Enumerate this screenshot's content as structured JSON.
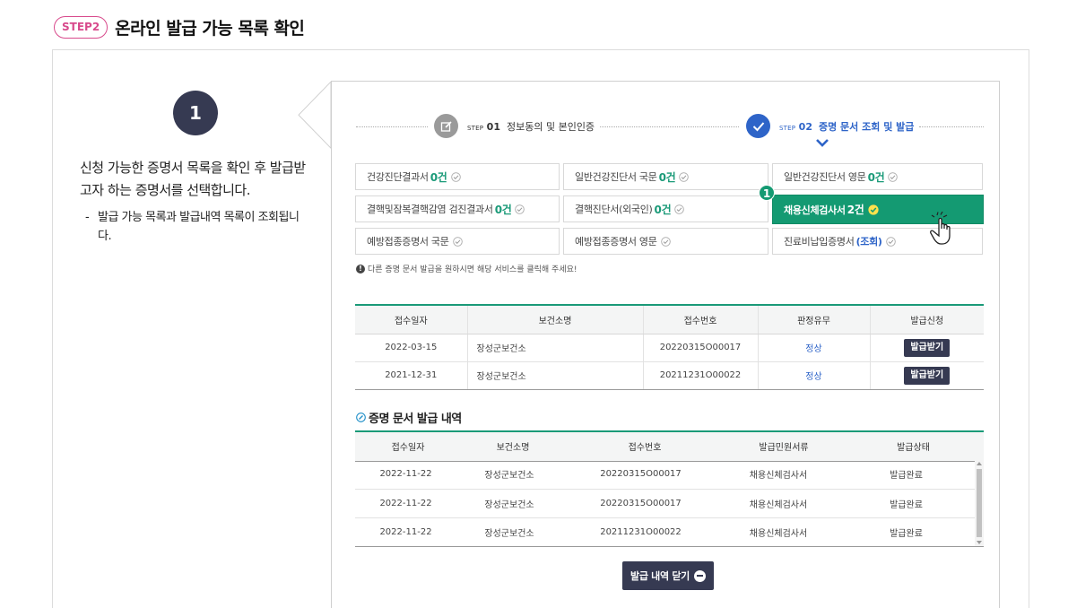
{
  "header": {
    "step_badge": "STEP2",
    "title": "온라인 발급 가능 목록 확인"
  },
  "left": {
    "step_number": "1",
    "description": "신청 가능한 증명서 목록을 확인 후 발급받고자 하는 증명서를 선택합니다.",
    "sub_dash": "-",
    "sub_text": "발급 가능 목록과 발급내역 목록이 조회됩니다."
  },
  "progress": {
    "step1": {
      "prefix": "STEP",
      "num": "01",
      "label": "정보동의 및 본인인증"
    },
    "step2": {
      "prefix": "STEP",
      "num": "02",
      "label": "증명 문서 조회 및 발급"
    }
  },
  "certificates": [
    {
      "name": "건강진단결과서",
      "count": "0건"
    },
    {
      "name": "일반건강진단서 국문",
      "count": "0건"
    },
    {
      "name": "일반건강진단서 영문",
      "count": "0건"
    },
    {
      "name": "결핵및잠복결핵감염 검진결과서",
      "count": "0건"
    },
    {
      "name": "결핵진단서(외국인)",
      "count": "0건"
    },
    {
      "name": "채용신체검사서",
      "count": "2건"
    },
    {
      "name": "예방접종증명서 국문",
      "count": ""
    },
    {
      "name": "예방접종증명서 영문",
      "count": ""
    },
    {
      "name": "진료비납입증명서",
      "query": "(조회)"
    }
  ],
  "selected_marker": "1",
  "notice": {
    "icon": "!",
    "text": "다른 증명 문서 발급을 원하시면 해당 서비스를 클릭해 주세요!"
  },
  "table1": {
    "headers": [
      "접수일자",
      "보건소명",
      "접수번호",
      "판정유무",
      "발급신청"
    ],
    "rows": [
      {
        "date": "2022-03-15",
        "center": "장성군보건소",
        "receipt": "20220315O00017",
        "result": "정상",
        "action": "발급받기"
      },
      {
        "date": "2021-12-31",
        "center": "장성군보건소",
        "receipt": "20211231O00022",
        "result": "정상",
        "action": "발급받기"
      }
    ]
  },
  "history": {
    "title": "증명 문서 발급 내역",
    "headers": [
      "접수일자",
      "보건소명",
      "접수번호",
      "발급민원서류",
      "발급상태"
    ],
    "rows": [
      {
        "date": "2022-11-22",
        "center": "장성군보건소",
        "receipt": "20220315O00017",
        "doc": "채용신체검사서",
        "status": "발급완료"
      },
      {
        "date": "2022-11-22",
        "center": "장성군보건소",
        "receipt": "20220315O00017",
        "doc": "채용신체검사서",
        "status": "발급완료"
      },
      {
        "date": "2022-11-22",
        "center": "장성군보건소",
        "receipt": "20211231O00022",
        "doc": "채용신체검사서",
        "status": "발급완료"
      }
    ]
  },
  "close_button": "발급 내역 닫기",
  "colors": {
    "accent_green": "#149a72",
    "accent_blue": "#2e64c8",
    "dark_navy": "#363a52",
    "badge_pink": "#d84a8c"
  }
}
